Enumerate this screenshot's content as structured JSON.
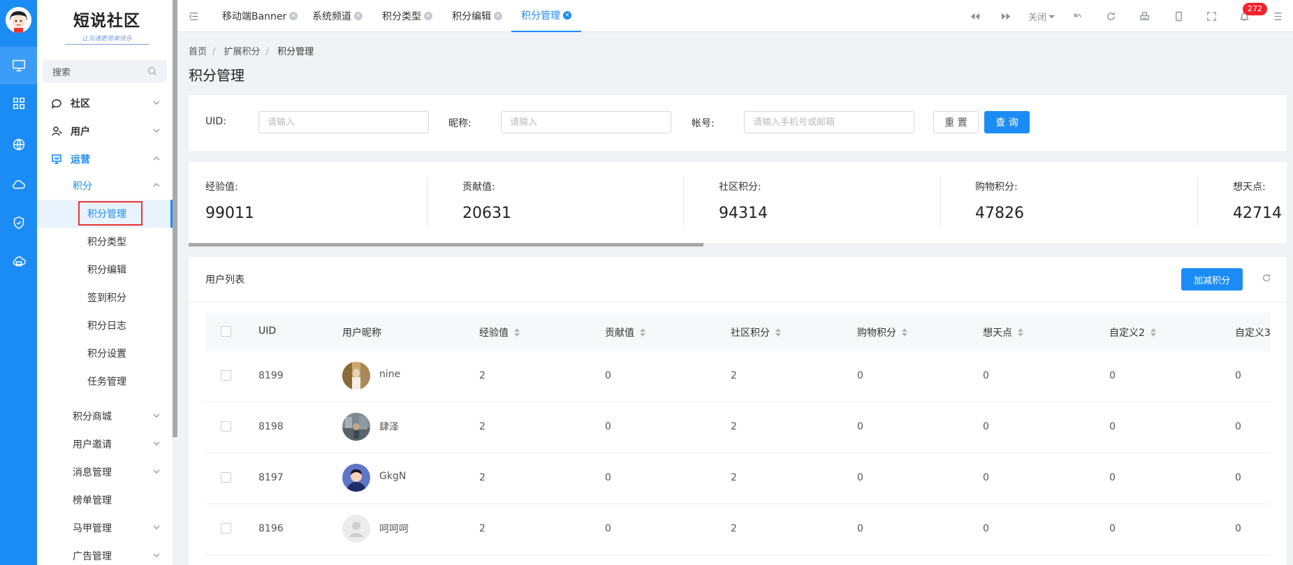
{
  "sidebar": {
    "logo_title": "短说社区",
    "logo_subtitle": "让沟通更简单快乐",
    "search_label": "搜索",
    "menu": [
      {
        "label": "社区"
      },
      {
        "label": "用户"
      },
      {
        "label": "运营"
      }
    ],
    "submenu_group": "积分",
    "submenu": [
      {
        "label": "积分管理"
      },
      {
        "label": "积分类型"
      },
      {
        "label": "积分编辑"
      },
      {
        "label": "签到积分"
      },
      {
        "label": "积分日志"
      },
      {
        "label": "积分设置"
      },
      {
        "label": "任务管理"
      }
    ],
    "more": [
      {
        "label": "积分商城"
      },
      {
        "label": "用户邀请"
      },
      {
        "label": "消息管理"
      },
      {
        "label": "榜单管理"
      },
      {
        "label": "马甲管理"
      },
      {
        "label": "广告管理"
      }
    ]
  },
  "tabs": [
    {
      "label": "移动端Banner"
    },
    {
      "label": "系统频道"
    },
    {
      "label": "积分类型"
    },
    {
      "label": "积分编辑"
    },
    {
      "label": "积分管理"
    }
  ],
  "toolbar": {
    "close_label": "关闭",
    "notification_count": "272"
  },
  "breadcrumb": [
    "首页",
    "扩展积分",
    "积分管理"
  ],
  "page_title": "积分管理",
  "filters": {
    "uid_label": "UID:",
    "uid_placeholder": "请输入",
    "nickname_label": "昵称:",
    "nickname_placeholder": "请输入",
    "account_label": "帐号:",
    "account_placeholder": "请输入手机号或邮箱",
    "reset_label": "重 置",
    "query_label": "查 询"
  },
  "stats": [
    {
      "label": "经验值:",
      "value": "99011"
    },
    {
      "label": "贡献值:",
      "value": "20631"
    },
    {
      "label": "社区积分:",
      "value": "94314"
    },
    {
      "label": "购物积分:",
      "value": "47826"
    },
    {
      "label": "想天点:",
      "value": "42714"
    }
  ],
  "list": {
    "title": "用户列表",
    "add_button": "加减积分",
    "columns": [
      "UID",
      "用户昵称",
      "经验值",
      "贡献值",
      "社区积分",
      "购物积分",
      "想天点",
      "自定义2",
      "自定义3"
    ],
    "rows": [
      {
        "uid": "8199",
        "nickname": "nine",
        "exp": "2",
        "contrib": "0",
        "community": "2",
        "shopping": "0",
        "xiangtian": "0",
        "custom2": "0",
        "custom3": "0"
      },
      {
        "uid": "8198",
        "nickname": "肆泽",
        "exp": "2",
        "contrib": "0",
        "community": "2",
        "shopping": "0",
        "xiangtian": "0",
        "custom2": "0",
        "custom3": "0"
      },
      {
        "uid": "8197",
        "nickname": "GkgN",
        "exp": "2",
        "contrib": "0",
        "community": "2",
        "shopping": "0",
        "xiangtian": "0",
        "custom2": "0",
        "custom3": "0"
      },
      {
        "uid": "8196",
        "nickname": "呵呵呵",
        "exp": "2",
        "contrib": "0",
        "community": "2",
        "shopping": "0",
        "xiangtian": "0",
        "custom2": "0",
        "custom3": "0"
      }
    ]
  },
  "colors": {
    "accent": "#1c8cf5",
    "rail": "#1c8cf5",
    "highlight_box": "#ee3333",
    "badge": "#f5222d"
  }
}
